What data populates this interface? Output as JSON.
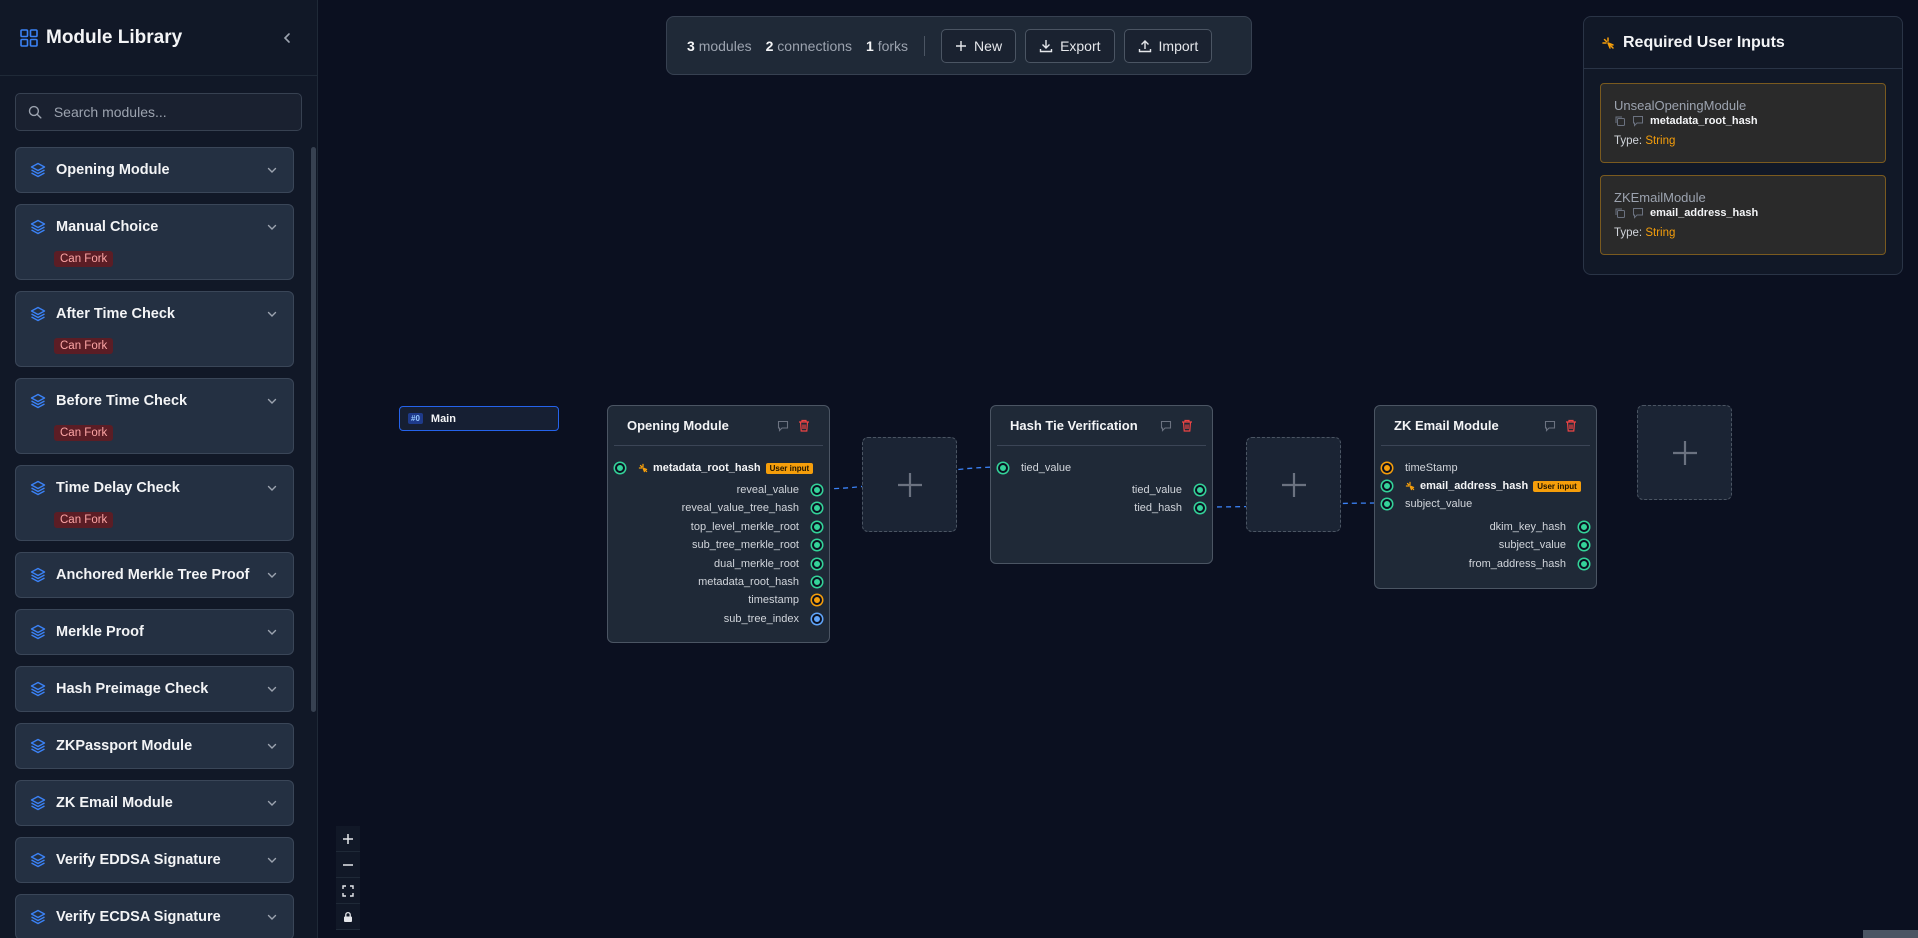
{
  "sidebar": {
    "title": "Module Library",
    "search_placeholder": "Search modules...",
    "modules": [
      {
        "name": "Opening Module",
        "badge": ""
      },
      {
        "name": "Manual Choice",
        "badge": "Can Fork"
      },
      {
        "name": "After Time Check",
        "badge": "Can Fork"
      },
      {
        "name": "Before Time Check",
        "badge": "Can Fork"
      },
      {
        "name": "Time Delay Check",
        "badge": "Can Fork"
      },
      {
        "name": "Anchored Merkle Tree Proof",
        "badge": ""
      },
      {
        "name": "Merkle Proof",
        "badge": ""
      },
      {
        "name": "Hash Preimage Check",
        "badge": ""
      },
      {
        "name": "ZKPassport Module",
        "badge": ""
      },
      {
        "name": "ZK Email Module",
        "badge": ""
      },
      {
        "name": "Verify EDDSA Signature",
        "badge": ""
      },
      {
        "name": "Verify ECDSA Signature",
        "badge": ""
      }
    ]
  },
  "toolbar": {
    "modules_count": "3",
    "modules_label": "modules",
    "connections_count": "2",
    "connections_label": "connections",
    "forks_count": "1",
    "forks_label": "forks",
    "new_label": "New",
    "export_label": "Export",
    "import_label": "Import"
  },
  "required_inputs": {
    "title": "Required User Inputs",
    "items": [
      {
        "module": "UnsealOpeningModule",
        "field": "metadata_root_hash",
        "type_label": "Type:",
        "type": "String"
      },
      {
        "module": "ZKEmailModule",
        "field": "email_address_hash",
        "type_label": "Type:",
        "type": "String"
      }
    ]
  },
  "lane": {
    "tag": "#0",
    "label": "Main"
  },
  "nodes": {
    "opening": {
      "title": "Opening Module",
      "input": "metadata_root_hash",
      "input_badge": "User input",
      "outputs": [
        "reveal_value",
        "reveal_value_tree_hash",
        "top_level_merkle_root",
        "sub_tree_merkle_root",
        "dual_merkle_root",
        "metadata_root_hash",
        "timestamp",
        "sub_tree_index"
      ]
    },
    "hashtie": {
      "title": "Hash Tie Verification",
      "input": "tied_value",
      "outputs": [
        "tied_value",
        "tied_hash"
      ]
    },
    "zkemail": {
      "title": "ZK Email Module",
      "inputs": [
        "timeStamp",
        "email_address_hash",
        "subject_value"
      ],
      "input_badge": "User input",
      "outputs": [
        "dkim_key_hash",
        "subject_value",
        "from_address_hash"
      ]
    }
  },
  "colors": {
    "accent_blue": "#2563eb",
    "port_green": "#34d399",
    "port_orange": "#f59e0b",
    "port_blue": "#60a5fa",
    "delete_red": "#ef4444",
    "fork_badge": "#5b1d25"
  }
}
